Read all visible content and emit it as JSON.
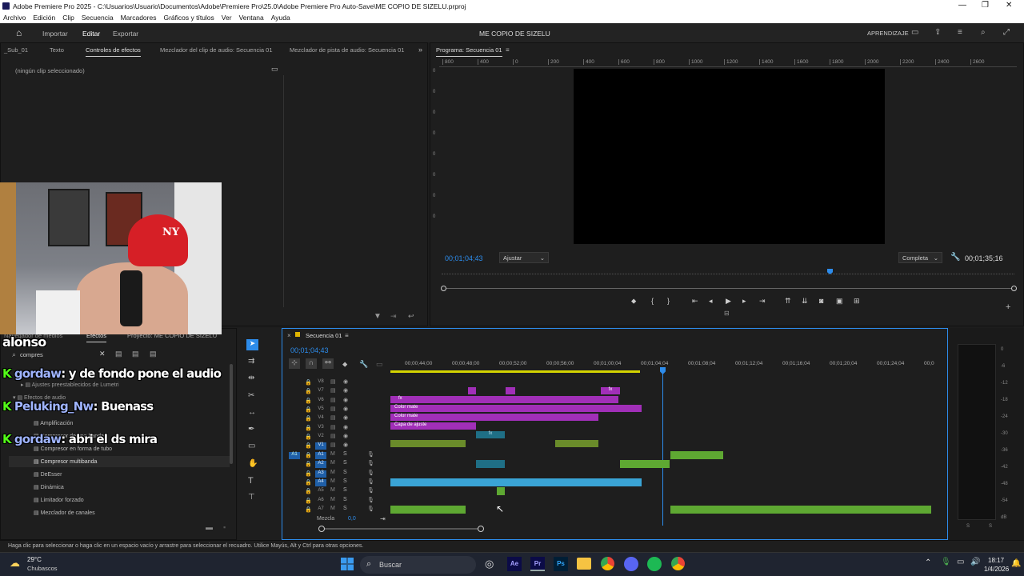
{
  "window": {
    "title": "Adobe Premiere Pro 2025 - C:\\Usuarios\\Usuario\\Documentos\\Adobe\\Premiere Pro\\25.0\\Adobe Premiere Pro Auto-Save\\ME COPIO DE SIZELU.prproj"
  },
  "menu": [
    "Archivo",
    "Edición",
    "Clip",
    "Secuencia",
    "Marcadores",
    "Gráficos y títulos",
    "Ver",
    "Ventana",
    "Ayuda"
  ],
  "header": {
    "tabs": [
      "Importar",
      "Editar",
      "Exportar"
    ],
    "active_tab": "Editar",
    "project_title": "ME COPIO DE SIZELU",
    "learn": "APRENDIZAJE"
  },
  "source_panel": {
    "tabs": [
      "_Sub_01",
      "Texto",
      "Controles de efectos",
      "Mezclador del clip de audio: Secuencia 01",
      "Mezclador de pista de audio: Secuencia 01"
    ],
    "empty_text": "(ningún clip seleccionado)"
  },
  "program": {
    "tab": "Programa: Secuencia 01",
    "ruler": [
      "800",
      "400",
      "0",
      "200",
      "400",
      "600",
      "800",
      "1000",
      "1200",
      "1400",
      "1600",
      "1800",
      "2000",
      "2200",
      "2400",
      "2600"
    ],
    "vruler": [
      "0",
      "0",
      "0",
      "0",
      "0",
      "0",
      "0",
      "0"
    ],
    "current_time": "00;01;04;43",
    "fit": "Ajustar",
    "quality": "Completa",
    "duration": "00;01;35;16"
  },
  "effects_panel": {
    "tabs": [
      "Navegador de medios",
      "Efectos",
      "Proyecto: ME COPIO DE SIZELU"
    ],
    "search": "compres",
    "items": [
      "Ajustes preestablecidos de Lumetri",
      "Efectos de audio",
      "Amplificación",
      "Compresor de una banda",
      "Compresor en forma de tubo",
      "Compresor multibanda",
      "DeEsser",
      "Dinámica",
      "Limitador forzado",
      "Mezclador de canales"
    ]
  },
  "stream": {
    "name": "alonso",
    "chat": [
      {
        "user": "gordaw",
        "msg": ": y de fondo pone el audio"
      },
      {
        "user": "Peluking_Nw",
        "msg": ": Buenass"
      },
      {
        "user": "gordaw",
        "msg": ": abri el ds mira"
      }
    ]
  },
  "timeline": {
    "tab": "Secuencia 01",
    "current_time": "00;01;04;43",
    "ruler": [
      "00;00;44;00",
      "00;00;48;00",
      "00;00;52;00",
      "00;00;56;00",
      "00;01;00;04",
      "00;01;04;04",
      "00;01;08;04",
      "00;01;12;04",
      "00;01;16;04",
      "00;01;20;04",
      "00;01;24;04",
      "00;0"
    ],
    "video_tracks": [
      "V8",
      "V7",
      "V6",
      "V5",
      "V4",
      "V3",
      "V2",
      "V1"
    ],
    "audio_tracks": [
      "A1",
      "A2",
      "A3",
      "A4",
      "A5",
      "A6",
      "A7"
    ],
    "clip_labels": [
      "Color mate",
      "Color mate",
      "Capa de ajuste"
    ],
    "mix_label": "Mezcla",
    "mix_value": "0,0",
    "meter_scale": [
      "0",
      "-6",
      "-12",
      "-18",
      "-24",
      "-30",
      "-36",
      "-42",
      "-48",
      "-54",
      "dB"
    ],
    "meter_ss": [
      "S",
      "S"
    ]
  },
  "status_bar": "Haga clic para seleccionar o haga clic en un espacio vacío y arrastre para seleccionar el recuadro. Utilice Mayús, Alt y Ctrl para otras opciones.",
  "taskbar": {
    "weather_temp": "29°C",
    "weather_desc": "Chubascos",
    "search": "Buscar",
    "time": "18:17",
    "date": "1/4/2026"
  },
  "colors": {
    "accent_blue": "#2d8ceb",
    "clip_purple": "#a12fb8",
    "clip_green": "#6a8c2a",
    "clip_teal": "#1f6f86",
    "audio_blue": "#3aa4d6",
    "audio_green": "#5ea832"
  }
}
